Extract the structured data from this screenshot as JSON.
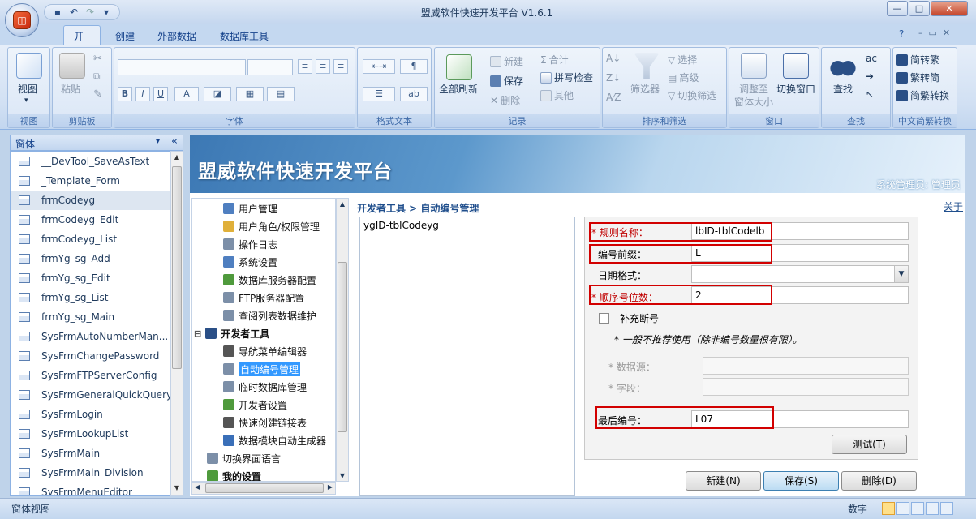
{
  "window": {
    "title": "盟威软件快速开发平台 V1.6.1"
  },
  "ribbon_tabs": [
    "开始",
    "创建",
    "外部数据",
    "数据库工具"
  ],
  "ribbon": {
    "view": {
      "label": "视图",
      "group": "视图"
    },
    "clipboard": {
      "paste": "粘贴",
      "group": "剪贴板"
    },
    "font": {
      "group": "字体",
      "bold": "B",
      "italic": "I",
      "underline": "U",
      "color": "A"
    },
    "rich_text": {
      "group": "格式文本"
    },
    "records": {
      "refresh_all": "全部刷新",
      "new": "新建",
      "save": "保存",
      "delete": "删除",
      "totals": "合计",
      "spelling": "拼写检查",
      "more": "其他",
      "group": "记录"
    },
    "sort_filter": {
      "filter": "筛选器",
      "selection": "选择",
      "advanced": "高级",
      "toggle": "切换筛选",
      "group": "排序和筛选"
    },
    "window": {
      "fit": "调整至",
      "fit2": "窗体大小",
      "switch": "切换窗口",
      "group": "窗口"
    },
    "find": {
      "label": "查找",
      "group": "查找"
    },
    "chinese": {
      "s2t": "简转繁",
      "t2s": "繁转简",
      "convert": "简繁转换",
      "group": "中文简繁转换"
    }
  },
  "left_pane": {
    "header": "窗体",
    "items": [
      "__DevTool_SaveAsText",
      "_Template_Form",
      "frmCodeyg",
      "frmCodeyg_Edit",
      "frmCodeyg_List",
      "frmYg_sg_Add",
      "frmYg_sg_Edit",
      "frmYg_sg_List",
      "frmYg_sg_Main",
      "SysFrmAutoNumberMan...",
      "SysFrmChangePassword",
      "SysFrmFTPServerConfig",
      "SysFrmGeneralQuickQuery",
      "SysFrmLogin",
      "SysFrmLookupList",
      "SysFrmMain",
      "SysFrmMain_Division",
      "SysFrmMenuEditor"
    ],
    "selected_index": 2
  },
  "banner": {
    "title": "盟威软件快速开发平台",
    "user": "系统管理员: 管理员"
  },
  "nav_tree": {
    "items": [
      "用户管理",
      "用户角色/权限管理",
      "操作日志",
      "系统设置",
      "数据库服务器配置",
      "FTP服务器配置",
      "查阅列表数据维护",
      "开发者工具",
      "导航菜单编辑器",
      "自动编号管理",
      "临时数据库管理",
      "开发者设置",
      "快速创建链接表",
      "数据模块自动生成器",
      "切换界面语言",
      "我的设置"
    ],
    "selected": "自动编号管理"
  },
  "breadcrumb": "开发者工具 > 自动编号管理",
  "about_link": "关于",
  "code_list": {
    "items": [
      "ygID-tblCodeyg"
    ]
  },
  "form": {
    "rule_name_label": "规则名称：",
    "rule_name_value": "lbID-tblCodelb",
    "prefix_label": "编号前缀：",
    "prefix_value": "L",
    "date_format_label": "日期格式：",
    "date_format_value": "",
    "seq_digits_label": "顺序号位数：",
    "seq_digits_value": "2",
    "fill_gap_label": "补充断号",
    "note": "* 一般不推荐使用（除非编号数量很有限）。",
    "datasource_label": "* 数据源：",
    "field_label": "* 字段：",
    "last_number_label": "最后编号：",
    "last_number_value": "L07",
    "test_button": "测试(T)",
    "new_button": "新建(N)",
    "save_button": "保存(S)",
    "delete_button": "删除(D)"
  },
  "status": {
    "left": "窗体视图",
    "right": "数字"
  }
}
